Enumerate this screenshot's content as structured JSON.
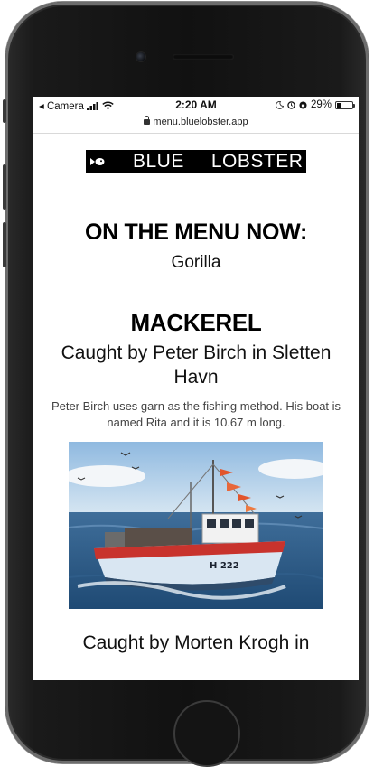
{
  "status_bar": {
    "back_app": "◂ Camera",
    "time": "2:20 AM",
    "battery": "29%",
    "battery_level": 0.29
  },
  "url": "menu.bluelobster.app",
  "logo": {
    "word1": "BLUE",
    "word2": "LOBSTER"
  },
  "menu": {
    "heading": "ON THE MENU NOW:",
    "current": "Gorilla"
  },
  "catch": {
    "fish": "MACKEREL",
    "caught_by": "Caught by Peter Birch in Sletten Havn",
    "description": "Peter Birch uses garn as the fishing method. His boat is named Rita and it is 10.67 m long.",
    "boat_reg": "H 222"
  },
  "next_catch": {
    "caught_by": "Caught by Morten Krogh in"
  },
  "icons": [
    "lock-icon",
    "signal-icon",
    "wifi-icon",
    "moon-icon",
    "alarm-icon",
    "battery-icon",
    "fish-logo-icon"
  ]
}
